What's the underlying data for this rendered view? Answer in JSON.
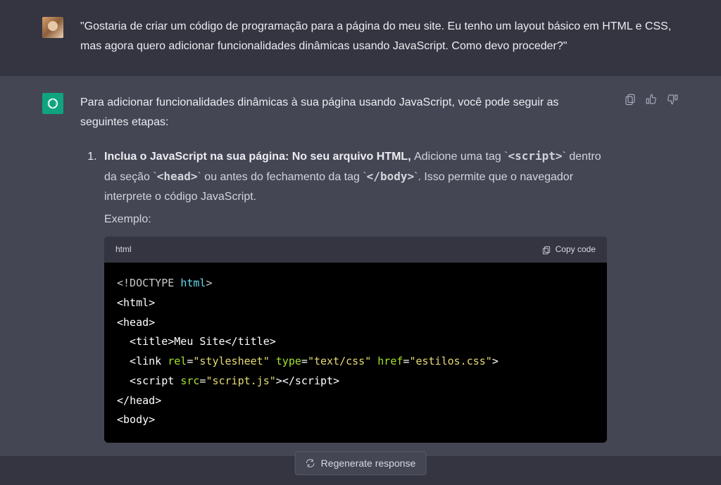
{
  "user": {
    "message": "\"Gostaria de criar um código de programação para a página do meu site. Eu tenho um layout básico em HTML e CSS, mas agora quero adicionar funcionalidades dinâmicas usando JavaScript. Como devo proceder?\""
  },
  "assistant": {
    "intro": "Para adicionar funcionalidades dinâmicas à sua página usando JavaScript, você pode seguir as seguintes etapas:",
    "step1": {
      "number": "1.",
      "segments": {
        "lead": "Inclua o JavaScript na sua página: No seu arquivo HTML, ",
        "a1": "Adicione uma tag `",
        "code1": "<script>",
        "a2": "` dentro da seção `",
        "code2": "<head>",
        "a3": "` ou antes do fechamento da tag `",
        "code3": "</body>",
        "a4": "`. Isso permite que o navegador interprete o código JavaScript."
      },
      "example_label": "Exemplo:"
    },
    "codeblock": {
      "lang": "html",
      "copy_label": "Copy code",
      "lines": {
        "l1_a": "<!DOCTYPE ",
        "l1_b": "html",
        "l1_c": ">",
        "l2_a": "<",
        "l2_b": "html",
        "l2_c": ">",
        "l3_a": "<",
        "l3_b": "head",
        "l3_c": ">",
        "l4_a": "  <",
        "l4_b": "title",
        "l4_c": ">",
        "l4_d": "Meu Site",
        "l4_e": "</",
        "l4_f": "title",
        "l4_g": ">",
        "l5_a": "  <",
        "l5_b": "link",
        "l5_sp1": " ",
        "l5_c": "rel",
        "l5_d": "=",
        "l5_e": "\"stylesheet\"",
        "l5_sp2": " ",
        "l5_f": "type",
        "l5_g": "=",
        "l5_h": "\"text/css\"",
        "l5_sp3": " ",
        "l5_i": "href",
        "l5_j": "=",
        "l5_k": "\"estilos.css\"",
        "l5_l": ">",
        "l6_a": "  <",
        "l6_b": "script",
        "l6_sp1": " ",
        "l6_c": "src",
        "l6_d": "=",
        "l6_e": "\"script.js\"",
        "l6_f": ">",
        "l6_g": "</",
        "l6_h": "script",
        "l6_i": ">",
        "l7_a": "</",
        "l7_b": "head",
        "l7_c": ">",
        "l8_a": "<",
        "l8_b": "body",
        "l8_c": ">"
      }
    }
  },
  "actions": {
    "copy_tooltip": "Copy",
    "thumbs_up": "Good response",
    "thumbs_down": "Bad response"
  },
  "regenerate": {
    "label": "Regenerate response"
  }
}
